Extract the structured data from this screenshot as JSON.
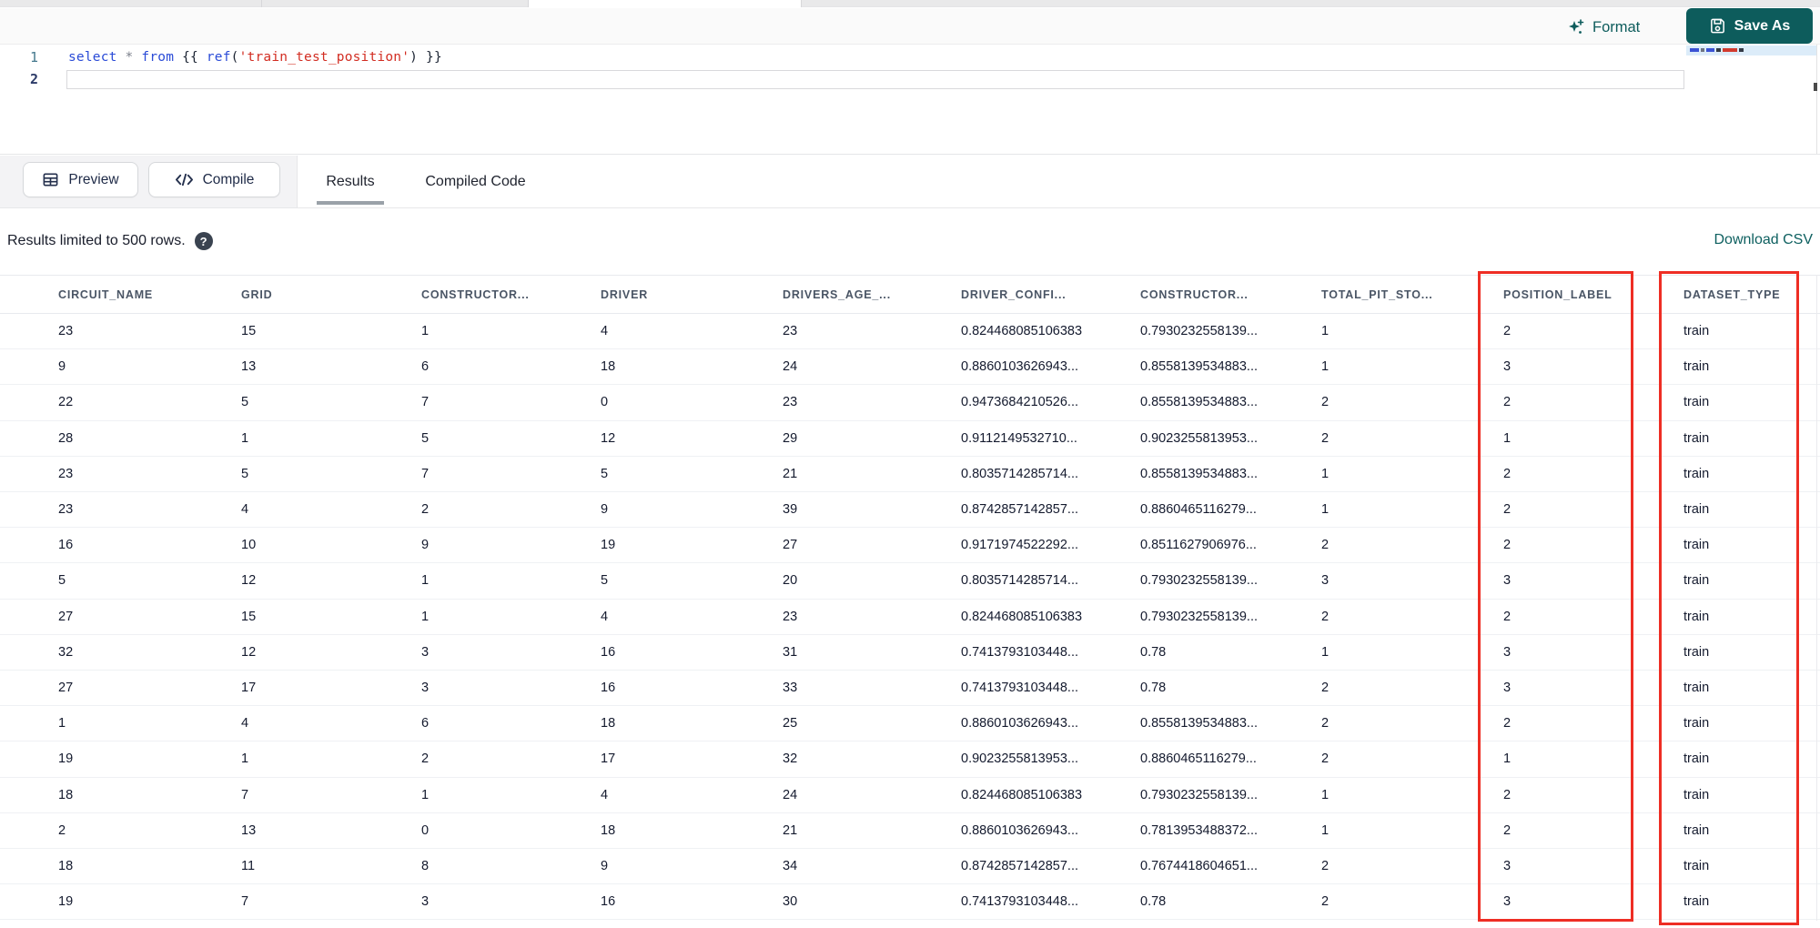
{
  "toolbar": {
    "format_label": "Format",
    "save_as_label": "Save As"
  },
  "editor": {
    "line_numbers": [
      "1",
      "2"
    ],
    "code_tokens": [
      {
        "text": "select",
        "type": "keyword"
      },
      {
        "text": " ",
        "type": "plain"
      },
      {
        "text": "*",
        "type": "operator"
      },
      {
        "text": " ",
        "type": "plain"
      },
      {
        "text": "from",
        "type": "keyword"
      },
      {
        "text": " ",
        "type": "plain"
      },
      {
        "text": "{{ ",
        "type": "plain"
      },
      {
        "text": "ref",
        "type": "keyword2"
      },
      {
        "text": "(",
        "type": "plain"
      },
      {
        "text": "'train_test_position'",
        "type": "string"
      },
      {
        "text": ")",
        "type": "plain"
      },
      {
        "text": " }}",
        "type": "plain"
      }
    ]
  },
  "panel": {
    "preview_label": "Preview",
    "compile_label": "Compile",
    "tabs": [
      {
        "label": "Results",
        "active": true
      },
      {
        "label": "Compiled Code",
        "active": false
      }
    ]
  },
  "results": {
    "limit_message": "Results limited to 500 rows.",
    "download_label": "Download CSV"
  },
  "table": {
    "columns": [
      "CIRCUIT_NAME",
      "GRID",
      "CONSTRUCTOR...",
      "DRIVER",
      "DRIVERS_AGE_...",
      "DRIVER_CONFI...",
      "CONSTRUCTOR...",
      "TOTAL_PIT_STO...",
      "POSITION_LABEL",
      "DATASET_TYPE"
    ],
    "highlighted_columns": [
      "POSITION_LABEL",
      "DATASET_TYPE"
    ],
    "rows": [
      [
        "23",
        "15",
        "1",
        "4",
        "23",
        "0.824468085106383",
        "0.7930232558139...",
        "1",
        "2",
        "train"
      ],
      [
        "9",
        "13",
        "6",
        "18",
        "24",
        "0.8860103626943...",
        "0.8558139534883...",
        "1",
        "3",
        "train"
      ],
      [
        "22",
        "5",
        "7",
        "0",
        "23",
        "0.9473684210526...",
        "0.8558139534883...",
        "2",
        "2",
        "train"
      ],
      [
        "28",
        "1",
        "5",
        "12",
        "29",
        "0.9112149532710...",
        "0.9023255813953...",
        "2",
        "1",
        "train"
      ],
      [
        "23",
        "5",
        "7",
        "5",
        "21",
        "0.8035714285714...",
        "0.8558139534883...",
        "1",
        "2",
        "train"
      ],
      [
        "23",
        "4",
        "2",
        "9",
        "39",
        "0.8742857142857...",
        "0.8860465116279...",
        "1",
        "2",
        "train"
      ],
      [
        "16",
        "10",
        "9",
        "19",
        "27",
        "0.9171974522292...",
        "0.8511627906976...",
        "2",
        "2",
        "train"
      ],
      [
        "5",
        "12",
        "1",
        "5",
        "20",
        "0.8035714285714...",
        "0.7930232558139...",
        "3",
        "3",
        "train"
      ],
      [
        "27",
        "15",
        "1",
        "4",
        "23",
        "0.824468085106383",
        "0.7930232558139...",
        "2",
        "2",
        "train"
      ],
      [
        "32",
        "12",
        "3",
        "16",
        "31",
        "0.7413793103448...",
        "0.78",
        "1",
        "3",
        "train"
      ],
      [
        "27",
        "17",
        "3",
        "16",
        "33",
        "0.7413793103448...",
        "0.78",
        "2",
        "3",
        "train"
      ],
      [
        "1",
        "4",
        "6",
        "18",
        "25",
        "0.8860103626943...",
        "0.8558139534883...",
        "2",
        "2",
        "train"
      ],
      [
        "19",
        "1",
        "2",
        "17",
        "32",
        "0.9023255813953...",
        "0.8860465116279...",
        "2",
        "1",
        "train"
      ],
      [
        "18",
        "7",
        "1",
        "4",
        "24",
        "0.824468085106383",
        "0.7930232558139...",
        "1",
        "2",
        "train"
      ],
      [
        "2",
        "13",
        "0",
        "18",
        "21",
        "0.8860103626943...",
        "0.7813953488372...",
        "1",
        "2",
        "train"
      ],
      [
        "18",
        "11",
        "8",
        "9",
        "34",
        "0.8742857142857...",
        "0.7674418604651...",
        "2",
        "3",
        "train"
      ],
      [
        "19",
        "7",
        "3",
        "16",
        "30",
        "0.7413793103448...",
        "0.78",
        "2",
        "3",
        "train"
      ]
    ]
  },
  "colors": {
    "accent_teal": "#0d5c5c",
    "highlight_red": "#ee2e24",
    "keyword_blue": "#2a4bd7",
    "string_red": "#d22d22"
  }
}
